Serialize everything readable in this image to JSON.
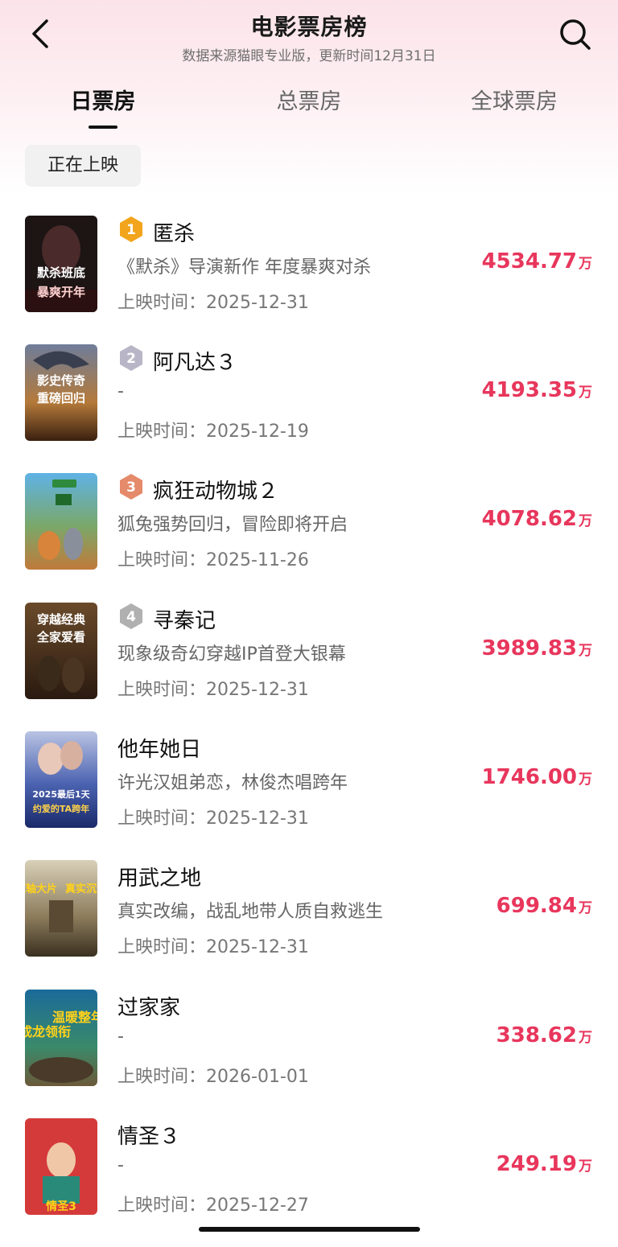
{
  "header": {
    "title": "电影票房榜",
    "subtitle": "数据来源猫眼专业版，更新时间12月31日",
    "back_icon": "chevron-left-icon",
    "search_icon": "search-icon"
  },
  "tabs": [
    {
      "label": "日票房",
      "active": true
    },
    {
      "label": "总票房",
      "active": false
    },
    {
      "label": "全球票房",
      "active": false
    }
  ],
  "filter": {
    "label": "正在上映"
  },
  "release_prefix": "上映时间：",
  "unit": "万",
  "colors": {
    "accent": "#e8365c",
    "gold": "#f2a51c",
    "silver": "#b8b6c6",
    "bronze": "#e58a6a",
    "gray_badge": "#b0b0b0"
  },
  "movies": [
    {
      "rank": "1",
      "title": "匿杀",
      "desc": "《默杀》导演新作 年度暴爽对杀",
      "release": "2025-12-31",
      "box": "4534.77",
      "poster_text": [
        "默杀班底",
        "暴爽开年"
      ]
    },
    {
      "rank": "2",
      "title": "阿凡达３",
      "desc": "-",
      "release": "2025-12-19",
      "box": "4193.35",
      "poster_text": [
        "影史传奇",
        "重磅回归"
      ]
    },
    {
      "rank": "3",
      "title": "疯狂动物城２",
      "desc": "狐兔强势回归，冒险即将开启",
      "release": "2025-11-26",
      "box": "4078.62",
      "poster_text": []
    },
    {
      "rank": "4",
      "title": "寻秦记",
      "desc": "现象级奇幻穿越IP首登大银幕",
      "release": "2025-12-31",
      "box": "3989.83",
      "poster_text": [
        "穿越经典",
        "全家爱看"
      ]
    },
    {
      "rank": "",
      "title": "他年她日",
      "desc": "许光汉姐弟恋，林俊杰唱跨年",
      "release": "2025-12-31",
      "box": "1746.00",
      "poster_text": [
        "2025最后1天",
        "约爱的TA跨年"
      ]
    },
    {
      "rank": "",
      "title": "用武之地",
      "desc": "真实改编，战乱地带人质自救逃生",
      "release": "2025-12-31",
      "box": "699.84",
      "poster_text": [
        "压轴大片",
        "真实沉浸"
      ]
    },
    {
      "rank": "",
      "title": "过家家",
      "desc": "-",
      "release": "2026-01-01",
      "box": "338.62",
      "poster_text": [
        "成龙领衔",
        "温暖整年"
      ]
    },
    {
      "rank": "",
      "title": "情圣３",
      "desc": "-",
      "release": "2025-12-27",
      "box": "249.19",
      "poster_text": [
        "情圣3"
      ]
    }
  ]
}
